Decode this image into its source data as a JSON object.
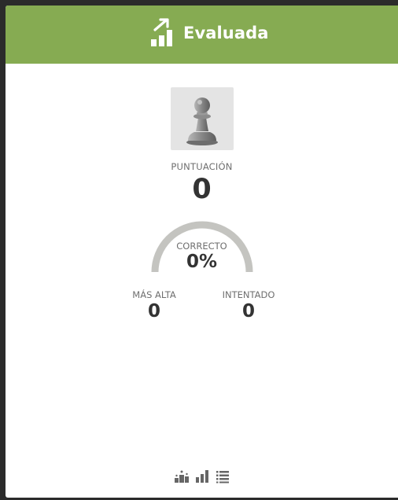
{
  "header": {
    "title": "Evaluada",
    "icon": "chart-growth-icon",
    "background_color": "#86ab52"
  },
  "avatar": {
    "icon": "chess-pawn-icon"
  },
  "score": {
    "label": "PUNTUACIÓN",
    "value": "0"
  },
  "correct": {
    "label": "CORRECTO",
    "value": "0%",
    "fraction": 0
  },
  "stats": {
    "highest": {
      "label": "MÁS ALTA",
      "value": "0"
    },
    "attempted": {
      "label": "INTENTADO",
      "value": "0"
    }
  },
  "footer": {
    "icons": [
      "podium-icon",
      "bar-chart-icon",
      "list-icon"
    ]
  }
}
